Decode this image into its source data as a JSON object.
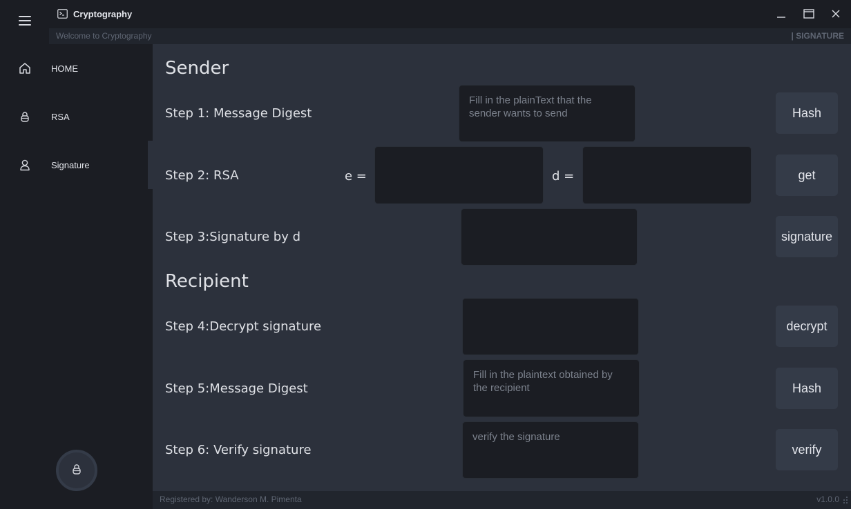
{
  "window": {
    "title": "Cryptography",
    "icon": "terminal-icon"
  },
  "top_info": {
    "left": "Welcome to Cryptography",
    "right": "| SIGNATURE"
  },
  "menu": {
    "toggle_icon": "hamburger-icon",
    "items": [
      {
        "label": "HOME",
        "icon": "home-icon"
      },
      {
        "label": "RSA",
        "icon": "lock-icon"
      },
      {
        "label": "Signature",
        "icon": "user-icon",
        "active": true
      }
    ],
    "avatar_icon": "lock-icon"
  },
  "sender": {
    "title": "Sender",
    "step1": {
      "label": "Step 1: Message Digest",
      "placeholder": "Fill in the plainText that the sender wants to send",
      "button": "Hash"
    },
    "step2": {
      "label": "Step 2: RSA",
      "e_label": "e =",
      "d_label": "d =",
      "button": "get"
    },
    "step3": {
      "label": "Step 3:Signature by d",
      "button": "signature"
    }
  },
  "recipient": {
    "title": "Recipient",
    "step4": {
      "label": "Step 4:Decrypt signature",
      "button": "decrypt"
    },
    "step5": {
      "label": "Step 5:Message Digest",
      "placeholder": "Fill in the plaintext obtained by the recipient",
      "button": "Hash"
    },
    "step6": {
      "label": "Step 6: Verify signature",
      "placeholder": "verify the signature",
      "button": "verify"
    }
  },
  "footer": {
    "credits": "Registered by: Wanderson M. Pimenta",
    "version": "v1.0.0"
  },
  "colors": {
    "background": "#1b1d23",
    "content": "#2c313c",
    "button": "#343b48",
    "input": "#1b1d23"
  }
}
